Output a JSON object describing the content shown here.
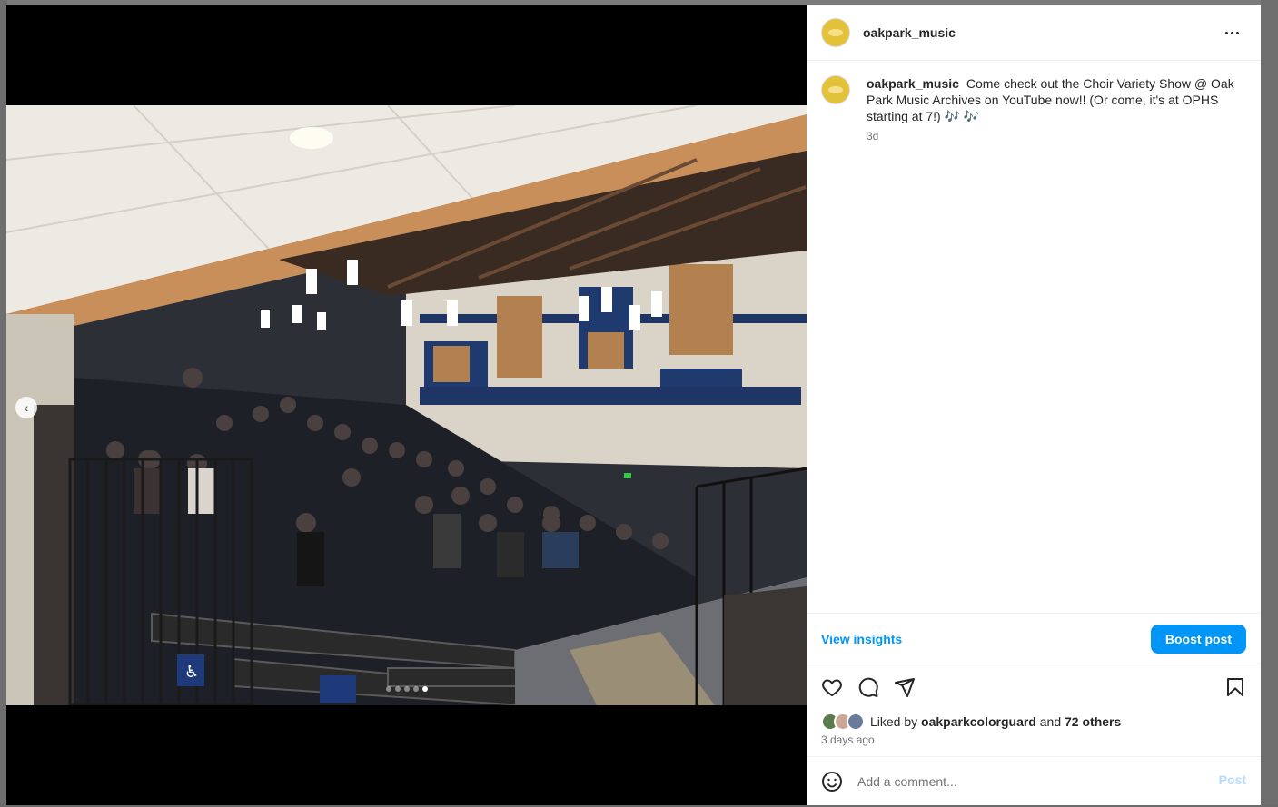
{
  "post": {
    "username": "oakpark_music",
    "avatar_icon": "gold-logo-avatar",
    "more_icon": "more-horizontal-icon",
    "caption_user": "oakpark_music",
    "caption_text": "Come check out the Choir Variety Show @ Oak Park Music Archives on YouTube now!! (Or come, it's at OPHS starting at 7!) 🎶 🎶",
    "caption_time": "3d",
    "carousel_total": 5,
    "carousel_active_index": 5
  },
  "insights": {
    "view_insights_label": "View insights",
    "boost_label": "Boost post"
  },
  "actions": {
    "like_icon": "heart-icon",
    "comment_icon": "comment-icon",
    "share_icon": "send-icon",
    "save_icon": "bookmark-icon"
  },
  "likes": {
    "prefix": "Liked by",
    "user": "oakparkcolorguard",
    "conjunction": "and",
    "others": "72 others"
  },
  "date_text": "3 days ago",
  "comment": {
    "placeholder": "Add a comment...",
    "post_label": "Post"
  },
  "colors": {
    "accent": "#0095f6",
    "post_disabled": "#b3dbff",
    "avatar": "#e3c23a"
  }
}
